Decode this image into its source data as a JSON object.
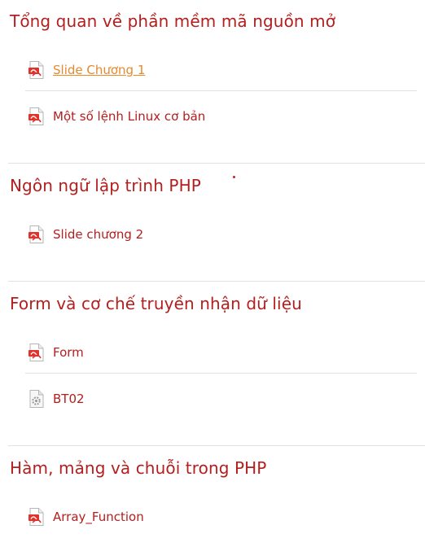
{
  "theme": {
    "title_color": "#b41e1e",
    "link_color": "#b41e1e",
    "active_link_color": "#e8892b",
    "divider_color": "#e2e2e2",
    "pdf_icon_color": "#e0332b",
    "file_icon_color": "#9a9a9a"
  },
  "sections": [
    {
      "title": "Tổng quan về phần mềm mã nguồn mở",
      "items": [
        {
          "label": "Slide Chương 1",
          "icon": "pdf-icon",
          "active": true
        },
        {
          "label": "Một số lệnh Linux cơ bản",
          "icon": "pdf-icon",
          "active": false
        }
      ]
    },
    {
      "title": "Ngôn ngữ lập trình PHP",
      "items": [
        {
          "label": "Slide chương 2",
          "icon": "pdf-icon",
          "active": false
        }
      ]
    },
    {
      "title": "Form và cơ chế truyền nhận dữ liệu",
      "items": [
        {
          "label": "Form",
          "icon": "pdf-icon",
          "active": false
        },
        {
          "label": "BT02",
          "icon": "generic-file-icon",
          "active": false
        }
      ]
    },
    {
      "title": "Hàm, mảng và chuỗi trong PHP",
      "items": [
        {
          "label": "Array_Function",
          "icon": "pdf-icon",
          "active": false
        }
      ]
    }
  ]
}
